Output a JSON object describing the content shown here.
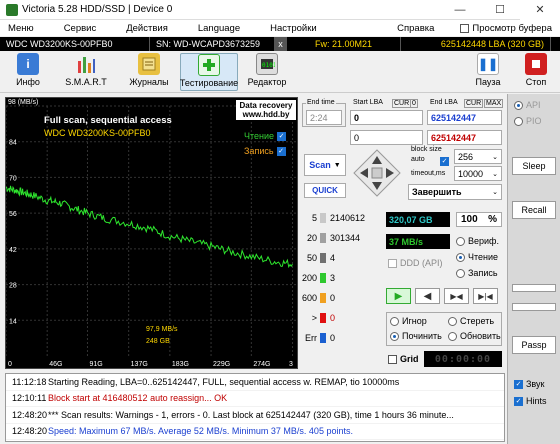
{
  "window": {
    "title": "Victoria 5.28 HDD/SSD | Device 0",
    "minimize": "—",
    "maximize": "☐",
    "close": "✕"
  },
  "menu": {
    "items": [
      "Меню",
      "Сервис",
      "Действия",
      "Language",
      "Настройки",
      "Справка"
    ],
    "buffer_view": "Просмотр буфера"
  },
  "infobar": {
    "model": "WDC WD3200KS-00PFB0",
    "serial": "SN: WD-WCAPD3673259",
    "close": "x",
    "firmware": "Fw: 21.00M21",
    "lba": "625142448 LBA (320 GB)"
  },
  "toolbar": {
    "info": "Инфо",
    "smart": "S.M.A.R.T",
    "journals": "Журналы",
    "testing": "Тестирование",
    "editor": "Редактор",
    "pause": "Пауза",
    "stop": "Стоп"
  },
  "graph": {
    "ymax_label": "98 (MB/s)",
    "title": "Full scan, sequential access",
    "model": "WDC WD3200KS-00PFB0",
    "recovery_line1": "Data recovery",
    "recovery_line2": "www.hdd.by",
    "read_label": "Чтение",
    "write_label": "Запись",
    "y_ticks": [
      "84",
      "70",
      "56",
      "42",
      "28",
      "14"
    ],
    "x_ticks": [
      "0",
      "46G",
      "91G",
      "137G",
      "183G",
      "229G",
      "274G",
      "3"
    ],
    "speed_readout": "97,9 MB/s",
    "size_readout": "248 GB"
  },
  "controls": {
    "end_time_label": "End time",
    "end_time": "2:24",
    "start_lba_label": "Start LBA",
    "cur_label": "CUR",
    "zero": "0",
    "end_lba_label": "End LBA",
    "max_label": "MAX",
    "start_lba": "0",
    "end_lba": "625142447",
    "cur_lba": "0",
    "end_lba2": "625142447",
    "scan_label": "Scan",
    "quick_label": "QUICK",
    "block_size_label": "block size",
    "auto_label": "auto",
    "block_size": "256",
    "timeout_label": "timeout,ms",
    "timeout": "10000",
    "action": "Завершить"
  },
  "blocks": [
    {
      "ms": "5",
      "count": "2140612",
      "color": "#c8c8c8"
    },
    {
      "ms": "20",
      "count": "301344",
      "color": "#a0a0a0"
    },
    {
      "ms": "50",
      "count": "4",
      "color": "#707070"
    },
    {
      "ms": "200",
      "count": "3",
      "color": "#2ec82e"
    },
    {
      "ms": "600",
      "count": "0",
      "color": "#f0a020"
    },
    {
      "ms": ">",
      "count": "0",
      "color": "#e01010"
    },
    {
      "ms": "Err",
      "count": "0",
      "color": "#1a5fd0"
    }
  ],
  "stats": {
    "scanned": "320,07 GB",
    "percent": "100",
    "percent_sign": "%",
    "speed": "37 MB/s",
    "ddd": "DDD (API)",
    "verify": "Вериф.",
    "read": "Чтение",
    "write": "Запись",
    "ignore": "Игнор",
    "erase": "Стереть",
    "repair": "Починить",
    "refresh": "Обновить",
    "grid": "Grid",
    "timer": "00:00:00"
  },
  "right_panel": {
    "api": "API",
    "pio": "PIO",
    "sleep": "Sleep",
    "recall": "Recall",
    "passp": "Passp",
    "sound": "Звук",
    "hints": "Hints"
  },
  "log": [
    {
      "time": "11:12:18",
      "text": "Starting Reading, LBA=0..625142447, FULL, sequential access w. REMAP, tio 10000ms",
      "color": "#000000"
    },
    {
      "time": "12:10:11",
      "text": "Block start at 416480512 auto reassign... OK",
      "color": "#c00000"
    },
    {
      "time": "12:48:20",
      "text": "*** Scan results: Warnings - 1, errors - 0. Last block at 625142447 (320 GB), time 1 hours 36 minute...",
      "color": "#000000"
    },
    {
      "time": "12:48:20",
      "text": "Speed: Maximum 67 MB/s. Average 52 MB/s. Minimum 37 MB/s. 405 points.",
      "color": "#1a3fd0"
    }
  ],
  "chart_data": {
    "type": "line",
    "title": "Full scan, sequential access",
    "xlabel": "",
    "ylabel": "(MB/s)",
    "ylim": [
      0,
      98
    ],
    "x_tick_labels": [
      "0",
      "46G",
      "91G",
      "137G",
      "183G",
      "229G",
      "274G"
    ],
    "series": [
      {
        "name": "Чтение",
        "x_gb": [
          0,
          10,
          20,
          30,
          46,
          60,
          75,
          91,
          110,
          137,
          160,
          183,
          205,
          229,
          250,
          274,
          300,
          320
        ],
        "values": [
          66,
          65,
          64,
          63,
          61,
          60,
          58,
          56,
          54,
          52,
          50,
          47,
          45,
          43,
          41,
          39,
          37,
          36
        ]
      }
    ],
    "grid": true
  }
}
